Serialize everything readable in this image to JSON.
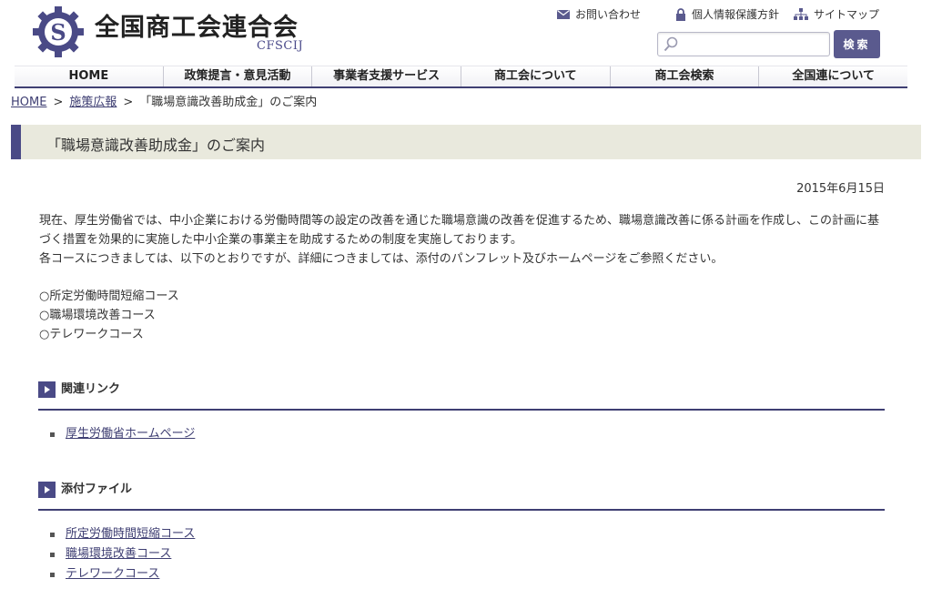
{
  "header": {
    "site_title": "全国商工会連合会",
    "site_subtitle": "CFSCIJ",
    "logo_icon": "gear-s-logo-icon",
    "util_links": [
      {
        "label": "お問い合わせ",
        "icon": "mail-icon"
      },
      {
        "label": "個人情報保護方針",
        "icon": "lock-icon"
      },
      {
        "label": "サイトマップ",
        "icon": "sitemap-icon"
      }
    ],
    "search": {
      "placeholder": "",
      "value": "",
      "button_label": "検索"
    }
  },
  "nav": {
    "items": [
      "HOME",
      "政策提言・意見活動",
      "事業者支援サービス",
      "商工会について",
      "商工会検索",
      "全国連について"
    ]
  },
  "breadcrumb": {
    "items": [
      "HOME",
      "施策広報"
    ],
    "separator": ">",
    "current": "「職場意識改善助成金」のご案内"
  },
  "page": {
    "title": "「職場意識改善助成金」のご案内",
    "date": "2015年6月15日",
    "paragraph1": "現在、厚生労働省では、中小企業における労働時間等の設定の改善を通じた職場意識の改善を促進するため、職場意識改善に係る計画を作成し、この計画に基づく措置を効果的に実施した中小企業の事業主を助成するための制度を実施しております。",
    "paragraph2": "各コースにつきましては、以下のとおりですが、詳細につきましては、添付のパンフレット及びホームページをご参照ください。",
    "courses": [
      "○所定労働時間短縮コース",
      "○職場環境改善コース",
      "○テレワークコース"
    ]
  },
  "sections": {
    "related": {
      "title": "関連リンク",
      "links": [
        "厚生労働省ホームページ"
      ]
    },
    "attachments": {
      "title": "添付ファイル",
      "links": [
        "所定労働時間短縮コース",
        "職場環境改善コース",
        "テレワークコース"
      ]
    }
  },
  "colors": {
    "brand": "#4a4a86",
    "heading_bg": "#e9e9dd",
    "link": "#3f3f73"
  }
}
